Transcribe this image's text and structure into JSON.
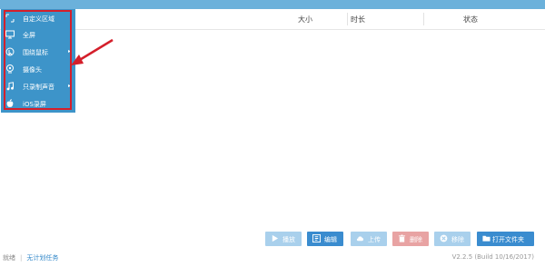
{
  "columns": {
    "size": "大小",
    "duration": "时长",
    "status": "状态"
  },
  "menu": {
    "items": [
      {
        "label": "自定义区域",
        "icon": "region-icon",
        "submenu": false
      },
      {
        "label": "全屏",
        "icon": "monitor-icon",
        "submenu": false
      },
      {
        "label": "围绕鼠标",
        "icon": "mouse-area-icon",
        "submenu": true
      },
      {
        "label": "摄像头",
        "icon": "webcam-icon",
        "submenu": false
      },
      {
        "label": "只录制声音",
        "icon": "music-note-icon",
        "submenu": true
      },
      {
        "label": "iOS录屏",
        "icon": "apple-icon",
        "submenu": false
      }
    ],
    "submenu_arrow": "▸"
  },
  "toolbar": {
    "play_label": "播放",
    "edit_label": "编辑",
    "upload_label": "上传",
    "delete_label": "删除",
    "move_label": "移除",
    "open_folder_label": "打开文件夹"
  },
  "colors": {
    "menu_bg": "#3d94c9",
    "highlight_border": "#d41f2b",
    "button_active": "#3a8ccf",
    "button_disabled": "#a9d0ec",
    "button_delete_disabled": "#e8a3a3"
  },
  "footer": {
    "status": "就绪",
    "schedule_link": "无计划任务"
  },
  "version": "V2.2.5 (Build 10/16/2017)"
}
